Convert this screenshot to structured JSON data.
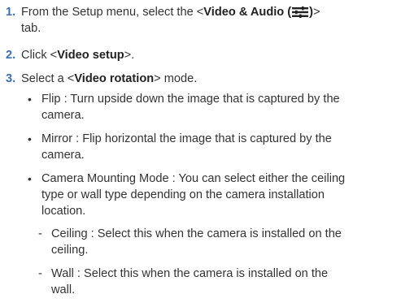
{
  "steps": [
    {
      "num": "1.",
      "pre": "From the Setup menu, select the <",
      "bold": "Video & Audio (",
      "icon": "video-audio-settings-icon",
      "bold_close": ")",
      "post": "> tab.",
      "line2": "tab."
    },
    {
      "num": "2.",
      "pre": "Click <",
      "bold": "Video setup",
      "post": ">."
    },
    {
      "num": "3.",
      "pre": "Select a <",
      "bold": "Video rotation",
      "post": "> mode."
    }
  ],
  "bullets": [
    {
      "line1": "Flip : Turn upside down the image that is captured by the",
      "line2": "camera."
    },
    {
      "line1": "Mirror : Flip horizontal the image that is captured by the",
      "line2": "camera."
    },
    {
      "line1": "Camera Mounting Mode : You can select either the ceiling",
      "line2": "type or wall type depending on the camera installation",
      "line3": "location."
    }
  ],
  "dashes": [
    {
      "line1": "Ceiling : Select this when the camera is installed on the",
      "line2": "ceiling."
    },
    {
      "line1": "Wall : Select this when the camera is installed on the",
      "line2": "wall."
    }
  ],
  "glyphs": {
    "bullet": "•",
    "dash": "-"
  }
}
